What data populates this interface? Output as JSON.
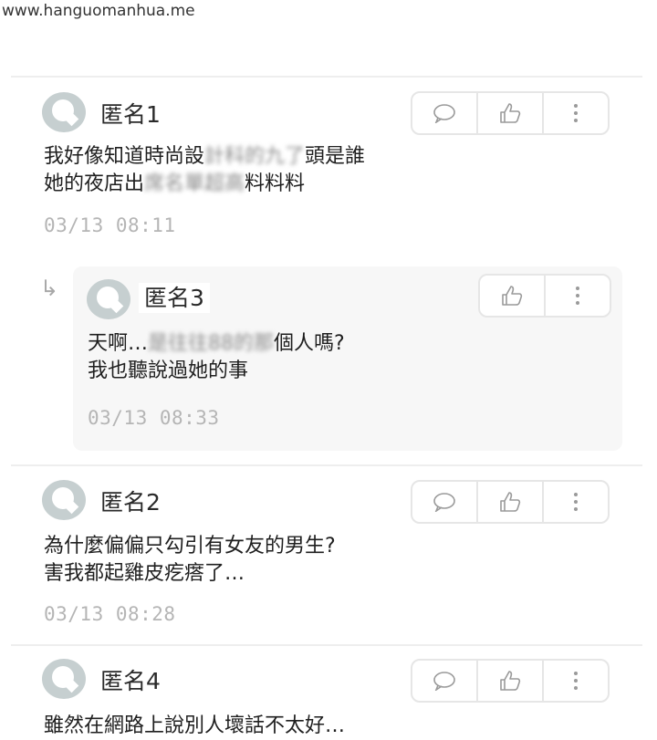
{
  "watermark": "www.hanguomanhua.me",
  "comments": [
    {
      "author": "匿名1",
      "line1": "我好像知道時尚設",
      "line1_hidden": "計科的九了",
      "line1_tail": "頭是誰",
      "line2": "她的夜店出",
      "line2_hidden": "席名單超高",
      "line2_tail": "料料料",
      "time": "03/13  08:11",
      "actions": [
        "comment-icon",
        "thumbs-up-icon",
        "more-icon"
      ]
    },
    {
      "author": "匿名3",
      "is_reply": true,
      "line1": "天啊…",
      "line1_hidden": "是往往88的那",
      "line1_tail": "個人嗎?",
      "line2": "我也聽說過她的事",
      "time": "03/13  08:33",
      "actions": [
        "thumbs-up-icon",
        "more-icon"
      ]
    },
    {
      "author": "匿名2",
      "line1": "為什麼偏偏只勾引有女友的男生?",
      "line2": "害我都起雞皮疙瘩了…",
      "time": "03/13  08:28",
      "actions": [
        "comment-icon",
        "thumbs-up-icon",
        "more-icon"
      ]
    },
    {
      "author": "匿名4",
      "line1": "雖然在網路上說別人壞話不太好…",
      "actions": [
        "comment-icon",
        "thumbs-up-icon",
        "more-icon"
      ]
    }
  ],
  "colors": {
    "avatar": "#c6cfd0",
    "time": "#b5b5b5",
    "reply_bg": "#f7f7f7",
    "border": "#e6e6e6"
  }
}
